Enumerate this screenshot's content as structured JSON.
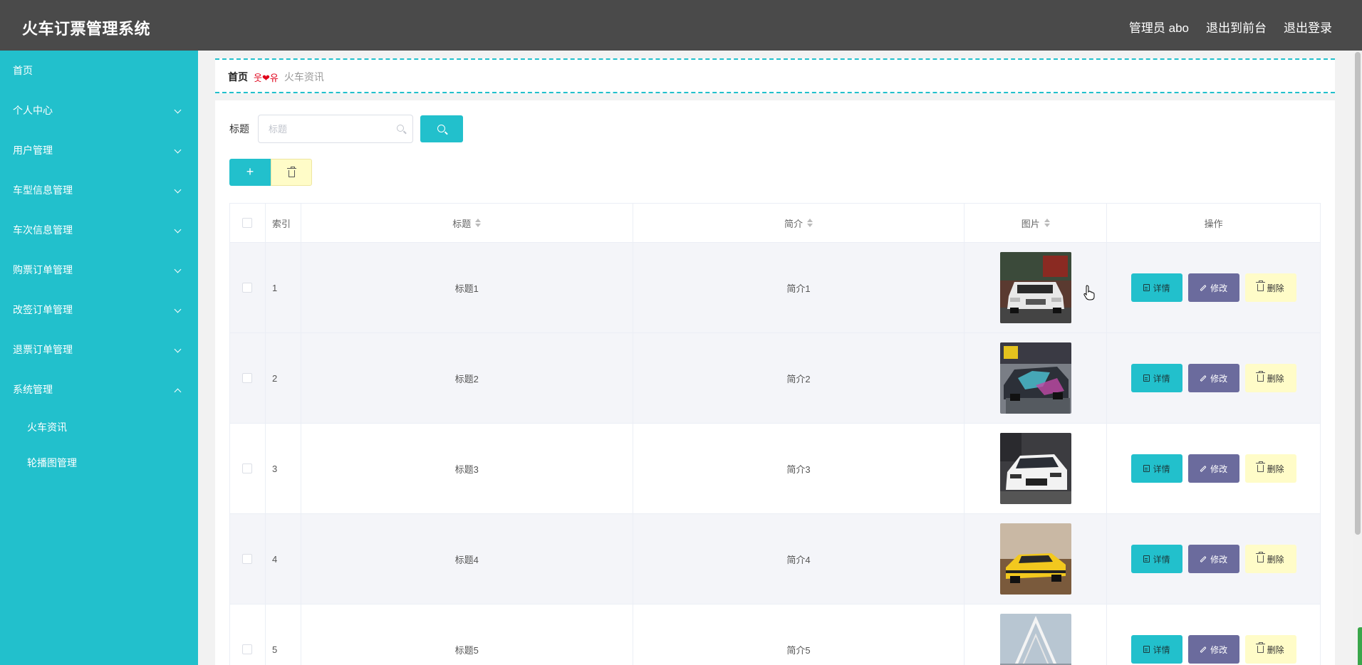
{
  "header": {
    "app_title": "火车订票管理系统",
    "admin_label": "管理员 abo",
    "to_front": "退出到前台",
    "logout": "退出登录"
  },
  "sidebar": {
    "items": [
      {
        "label": "首页",
        "chevron": "none"
      },
      {
        "label": "个人中心",
        "chevron": "down"
      },
      {
        "label": "用户管理",
        "chevron": "down"
      },
      {
        "label": "车型信息管理",
        "chevron": "down"
      },
      {
        "label": "车次信息管理",
        "chevron": "down"
      },
      {
        "label": "购票订单管理",
        "chevron": "down"
      },
      {
        "label": "改签订单管理",
        "chevron": "down"
      },
      {
        "label": "退票订单管理",
        "chevron": "down"
      },
      {
        "label": "系统管理",
        "chevron": "up"
      }
    ],
    "subitems": [
      {
        "label": "火车资讯"
      },
      {
        "label": "轮播图管理"
      }
    ]
  },
  "breadcrumb": {
    "home": "首页",
    "separator": "웃❤유",
    "current": "火车资讯"
  },
  "search": {
    "label": "标题",
    "placeholder": "标题",
    "value": ""
  },
  "table": {
    "columns": {
      "index": "索引",
      "title": "标题",
      "brief": "简介",
      "image": "图片",
      "ops": "操作"
    },
    "op_labels": {
      "detail": "详情",
      "edit": "修改",
      "delete": "删除"
    },
    "rows": [
      {
        "index": "1",
        "title": "标题1",
        "brief": "简介1",
        "image": "white-suv-photo"
      },
      {
        "index": "2",
        "title": "标题2",
        "brief": "简介2",
        "image": "wrapped-sports-car-photo"
      },
      {
        "index": "3",
        "title": "标题3",
        "brief": "简介3",
        "image": "white-sedan-photo"
      },
      {
        "index": "4",
        "title": "标题4",
        "brief": "简介4",
        "image": "yellow-muscle-car-photo"
      },
      {
        "index": "5",
        "title": "标题5",
        "brief": "简介5",
        "image": "car-bridge-photo"
      }
    ]
  },
  "colors": {
    "header_bg": "#4a4a4a",
    "accent_teal": "#22c0cc",
    "edit_purple": "#6b6b9d",
    "delete_yellow": "#fffcc8"
  }
}
